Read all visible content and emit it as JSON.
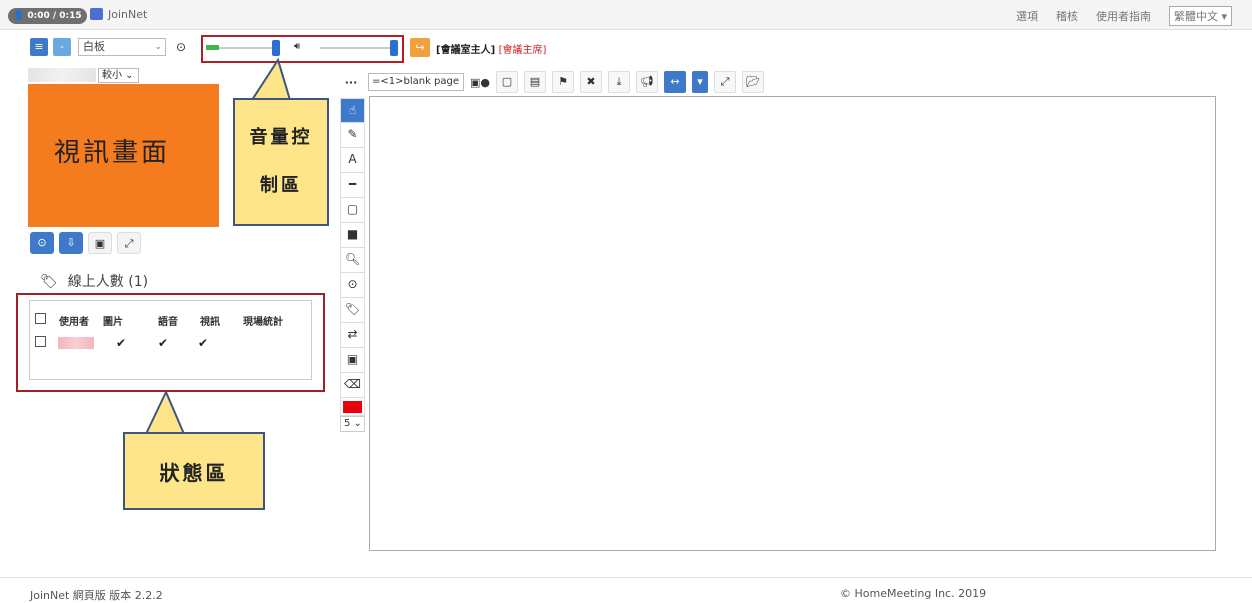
{
  "header": {
    "session_time": "0:00 / 0:15",
    "app_name": "JoinNet",
    "links": [
      "選項",
      "稽核",
      "使用者指南"
    ],
    "language": "繁體中文"
  },
  "toolbar": {
    "mode_select": "白板",
    "host_label": "[會議室主人]",
    "host_role": "[會議主席]"
  },
  "left": {
    "size_select": "較小",
    "video_label": "視訊畫面",
    "online_count": "線上人數 (1)",
    "status_headers": [
      "使用者",
      "圖片",
      "語音",
      "視訊",
      "現場統計"
    ],
    "status_checks": [
      "✔",
      "✔",
      "✔"
    ]
  },
  "callouts": {
    "volume_line1": "音量控",
    "volume_line2": "制區",
    "status": "狀態區"
  },
  "whiteboard": {
    "page_select": "=<1>blank page",
    "pen_size": "5"
  },
  "footer": {
    "version": "JoinNet 網頁版 版本 2.2.2",
    "copyright": "© HomeMeeting Inc. 2019"
  },
  "colors": {
    "accent_blue": "#3e7ac9",
    "video_orange": "#f47c1f",
    "callout_yellow": "#fee589",
    "highlight_red": "#b0202a",
    "pen_color": "#e8000d"
  }
}
